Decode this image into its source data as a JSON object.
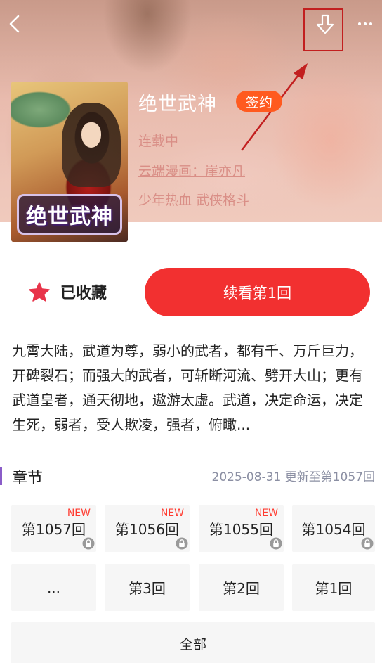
{
  "topbar": {
    "back_icon": "chevron-left-icon",
    "download_icon": "download-arrow-icon",
    "more_icon": "more-dots-icon",
    "more_label": "···"
  },
  "comic": {
    "title": "绝世武神",
    "badge": "签约",
    "status": "连载中",
    "author": "云端漫画：崖亦凡",
    "tags": "少年热血 武侠格斗",
    "cover_logo_text": "绝世武神"
  },
  "actions": {
    "favorite_label": "已收藏",
    "favorite_icon": "star-icon",
    "continue_label": "续看第1回"
  },
  "description": "九霄大陆，武道为尊，弱小的武者，都有千、万斤巨力，开碑裂石；而强大的武者，可斩断河流、劈开大山；更有武道皇者，通天彻地，遨游太虚。武道，决定命运，决定生死，弱者，受人欺凌，强者，俯瞰...",
  "chapters": {
    "section_title": "章节",
    "update_info": "2025-08-31 更新至第1057回",
    "row1": [
      {
        "label": "第1057回",
        "new": "NEW",
        "locked": true
      },
      {
        "label": "第1056回",
        "new": "NEW",
        "locked": true
      },
      {
        "label": "第1055回",
        "new": "NEW",
        "locked": true
      },
      {
        "label": "第1054回",
        "new": "",
        "locked": true
      }
    ],
    "row2": [
      {
        "label": "..."
      },
      {
        "label": "第3回"
      },
      {
        "label": "第2回"
      },
      {
        "label": "第1回"
      }
    ],
    "all_label": "全部"
  },
  "colors": {
    "accent_red": "#f23030",
    "badge_orange": "#ff5a1f",
    "star_red": "#e8344a",
    "new_red": "#ff3b30",
    "section_bar": "#8a5cc8",
    "annotation_red": "#c21f1f"
  }
}
